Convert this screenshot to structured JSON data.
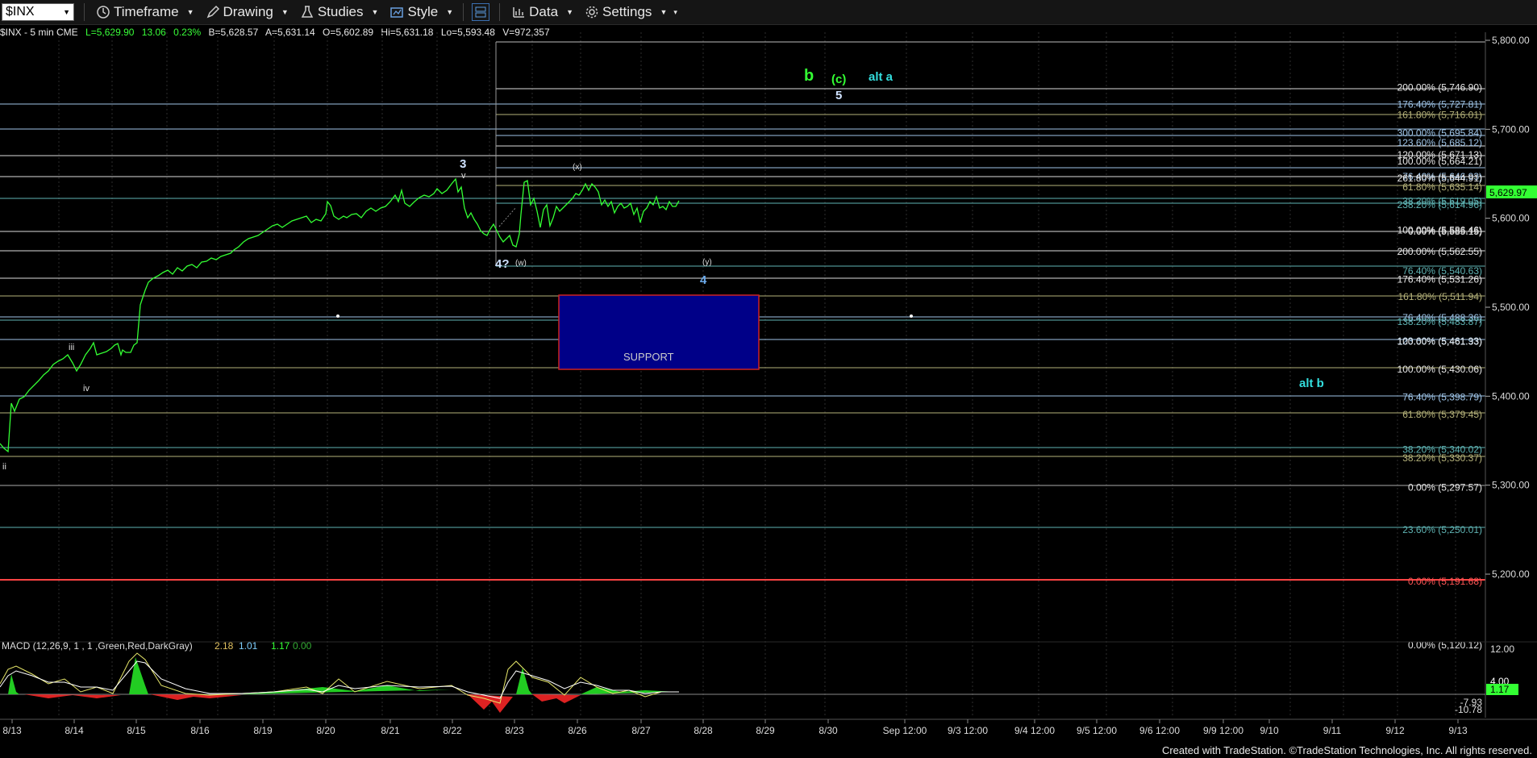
{
  "toolbar": {
    "symbol": "$INX",
    "timeframe": "Timeframe",
    "drawing": "Drawing",
    "studies": "Studies",
    "style": "Style",
    "data": "Data",
    "settings": "Settings"
  },
  "info": {
    "symbol_desc": "$INX - 5 min  CME",
    "last": "L=5,629.90",
    "change": "13.06",
    "pct": "0.23%",
    "bid": "B=5,628.57",
    "ask": "A=5,631.14",
    "open": "O=5,602.89",
    "high": "Hi=5,631.18",
    "low": "Lo=5,593.48",
    "volume": "V=972,357"
  },
  "price_axis": {
    "labels": [
      "5,800.00",
      "5,700.00",
      "5,600.00",
      "5,500.00",
      "5,400.00",
      "5,300.00",
      "5,200.00"
    ],
    "current": "5,629.97"
  },
  "fib_levels": [
    {
      "label": "200.00% (5,746.90)",
      "color": "#e8e8e8"
    },
    {
      "label": "176.40% (5,727.81)",
      "color": "#9fc5e8"
    },
    {
      "label": "161.80% (5,716.01)",
      "color": "#b5b27a"
    },
    {
      "label": "300.00% (5,695.84)",
      "color": "#9fc5e8"
    },
    {
      "label": "123.60% (5,685.12)",
      "color": "#9fc5e8"
    },
    {
      "label": "120.00% (5,671.13)",
      "color": "#e8e8e8"
    },
    {
      "label": "100.00% (5,664.21)",
      "color": "#e8e8e8"
    },
    {
      "label": "76.40% (5,646.93)",
      "color": "#9fc5e8"
    },
    {
      "label": "261.80% (5,644.91)",
      "color": "#e8e8e8"
    },
    {
      "label": "61.80% (5,635.14)",
      "color": "#b5b27a"
    },
    {
      "label": "38.20% (5,619.05)",
      "color": "#5fb3b3"
    },
    {
      "label": "238.20% (5,614.96)",
      "color": "#5fb3b3"
    },
    {
      "label": "100.00% (5,586.46)",
      "color": "#e8e8e8"
    },
    {
      "label": "0.00% (5,585.15)",
      "color": "#e8e8e8"
    },
    {
      "label": "200.00% (5,562.55)",
      "color": "#e8e8e8"
    },
    {
      "label": "76.40% (5,540.63)",
      "color": "#5fb3b3"
    },
    {
      "label": "176.40% (5,531.26)",
      "color": "#e8e8e8"
    },
    {
      "label": "161.80% (5,511.94)",
      "color": "#b5b27a"
    },
    {
      "label": "76.40% (5,488.36)",
      "color": "#9fc5e8"
    },
    {
      "label": "138.20% (5,483.87)",
      "color": "#5fb3b3"
    },
    {
      "label": "123.60% (5,461.93)",
      "color": "#9fc5e8"
    },
    {
      "label": "100.00% (5,461.33)",
      "color": "#e8e8e8"
    },
    {
      "label": "100.00% (5,430.06)",
      "color": "#e8e8e8"
    },
    {
      "label": "76.40% (5,398.79)",
      "color": "#9fc5e8"
    },
    {
      "label": "61.80% (5,379.45)",
      "color": "#b5b27a"
    },
    {
      "label": "38.20% (5,340.02)",
      "color": "#5fb3b3"
    },
    {
      "label": "38.20% (5,330.37)",
      "color": "#b5b27a"
    },
    {
      "label": "0.00% (5,297.57)",
      "color": "#e8e8e8"
    },
    {
      "label": "23.60% (5,250.01)",
      "color": "#5fb3b3"
    },
    {
      "label": "0.00% (5,191.68)",
      "color": "#ff5555"
    },
    {
      "label": "0.00% (5,120.12)",
      "color": "#e8e8e8"
    }
  ],
  "annotations": {
    "b": "b",
    "c": "(c)",
    "alt_a": "alt a",
    "five": "5",
    "three": "3",
    "v": "v",
    "x": "(x)",
    "four_q": "4?",
    "w": "(w)",
    "y": "(y)",
    "four": "4",
    "iii": "iii",
    "iv": "iv",
    "ii": "ii",
    "alt_b": "alt b",
    "support": "SUPPORT"
  },
  "macd": {
    "title": "MACD (12,26,9, 1 , 1 ,Green,Red,DarkGray)",
    "v1": "2.18",
    "v2": "1.01",
    "v3": "1.17",
    "v4": "0.00",
    "axis_labels": [
      "12.00",
      "4.00",
      "1.17",
      "-7.93",
      "-10.78"
    ]
  },
  "time_axis": [
    "8/13",
    "8/14",
    "8/15",
    "8/16",
    "8/19",
    "8/20",
    "8/21",
    "8/22",
    "8/23",
    "8/26",
    "8/27",
    "8/28",
    "8/29",
    "8/30",
    "Sep 12:00",
    "9/3 12:00",
    "9/4 12:00",
    "9/5 12:00",
    "9/6 12:00",
    "9/9 12:00",
    "9/10",
    "9/11",
    "9/12",
    "9/13"
  ],
  "footer": "Created with TradeStation. ©TradeStation Technologies, Inc. All rights reserved."
}
